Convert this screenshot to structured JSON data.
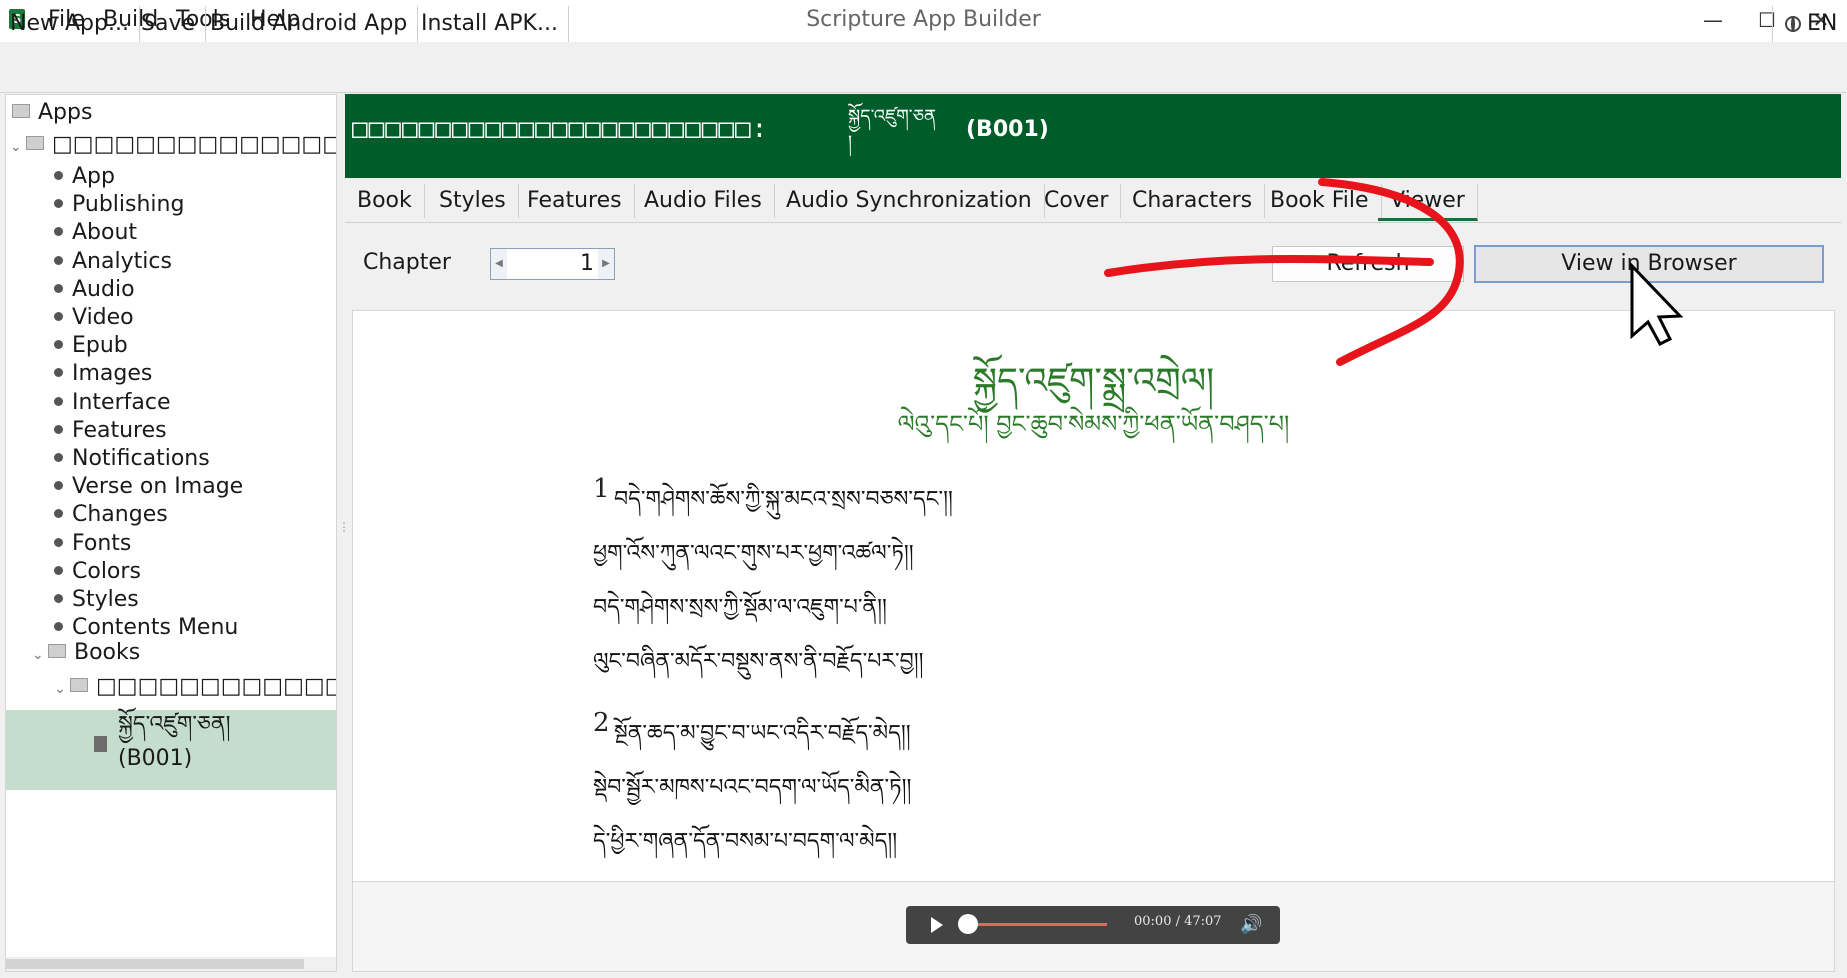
{
  "window": {
    "title": "Scripture App Builder",
    "menu": [
      "File",
      "Build",
      "Tools",
      "Help"
    ],
    "controls": [
      "—",
      "☐",
      "✕"
    ]
  },
  "toolbar": {
    "buttons": [
      "New App...",
      "Save",
      "Build Android App",
      "Install APK..."
    ],
    "language": "EN"
  },
  "tree": {
    "root": "Apps",
    "app_name": "□□□□□□□□□□□□□□□□□□□□□□□",
    "items": [
      "App",
      "Publishing",
      "About",
      "Analytics",
      "Audio",
      "Video",
      "Epub",
      "Images",
      "Interface",
      "Features",
      "Notifications",
      "Verse on Image",
      "Changes",
      "Fonts",
      "Colors",
      "Styles",
      "Contents Menu"
    ],
    "books_label": "Books",
    "collection_name": "□□□□□□□□□□□□□□□□□□□□",
    "book_name": "སྐྱོད་འཛུག་ཅན།",
    "book_code": "(B001)"
  },
  "header": {
    "boxes": "□□□□□□□□□□□□□□□□□□□□□□□□:",
    "tib_line1": "སྐྱོད་འཛུག་ཅན",
    "tib_line2": "།",
    "code": "(B001)"
  },
  "tabs": [
    "Book",
    "Styles",
    "Features",
    "Audio Files",
    "Audio Synchronization",
    "Cover",
    "Characters",
    "Book File",
    "Viewer"
  ],
  "active_tab": "Viewer",
  "viewer": {
    "chapter_label": "Chapter",
    "chapter_value": "1",
    "refresh": "Refresh",
    "view_in_browser": "View in Browser",
    "title": "སྐྱོད་འཛུག་སྨྲ་འགྲེལ།",
    "subtitle": "ལེའུ་དང་པོ། བྱང་ཆུབ་སེམས་ཀྱི་ཕན་ཡོན་བཤད་པ།",
    "verses": [
      {
        "num": "1",
        "lines": [
          "བདེ་གཤེགས་ཆོས་ཀྱི་སྐུ་མངའ་སྲས་བཅས་དང་།།",
          "ཕྱག་འོས་ཀུན་ལའང་གུས་པར་ཕྱག་འཚལ་ཏེ།།",
          "བདེ་གཤེགས་སྲས་ཀྱི་སྡོམ་ལ་འཇུག་པ་ནི།།",
          "ལུང་བཞིན་མདོར་བསྡུས་ནས་ནི་བརྗོད་པར་བྱ།།"
        ]
      },
      {
        "num": "2",
        "lines": [
          "སྔོན་ཆད་མ་བྱུང་བ་ཡང་འདིར་བརྗོད་མེད།།",
          "སྡེབ་སྦྱོར་མཁས་པའང་བདག་ལ་ཡོད་མིན་ཏེ།།",
          "དེ་ཕྱིར་གཞན་དོན་བསམ་པ་བདག་ལ་མེད།།"
        ]
      }
    ]
  },
  "audio": {
    "time": "00:00 / 47:07",
    "progress": 0
  },
  "colors": {
    "header_bg": "#005c28",
    "tab_active_underline": "#1e6b3d",
    "selection": "#c4ddcc",
    "annotation": "#e8141b"
  }
}
